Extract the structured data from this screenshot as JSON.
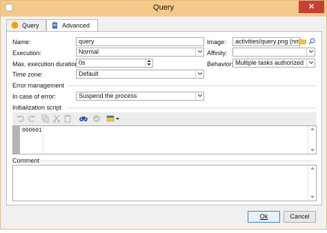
{
  "window": {
    "title": "Query",
    "close_glyph": "✕"
  },
  "tabs": [
    {
      "label": "Query",
      "icon": "query-circle-icon"
    },
    {
      "label": "Advanced",
      "icon": "clipboard-icon"
    }
  ],
  "form": {
    "name_label": "Name:",
    "name_value": "query",
    "image_label": "Image:",
    "image_value": "activities/query.png (nms",
    "execution_label": "Execution:",
    "execution_value": "Normal",
    "affinity_label": "Affinity:",
    "affinity_value": "",
    "max_exec_label": "Max. execution duration:",
    "max_exec_value": "0s",
    "behavior_label": "Behavior:",
    "behavior_value": "Multiple tasks authorized",
    "timezone_label": "Time zone:",
    "timezone_value": "Default"
  },
  "error_mgmt": {
    "section_label": "Error management",
    "in_case_label": "In case of error:",
    "in_case_value": "Suspend the process"
  },
  "script": {
    "section_label": "Initialization script",
    "line_number": "000001"
  },
  "comment": {
    "label": "Comment"
  },
  "buttons": {
    "ok": "Ok",
    "cancel": "Cancel"
  },
  "colors": {
    "titlebar": "#f5c98a",
    "close": "#c84031",
    "query_icon": "#f0a014",
    "clipboard": "#3a6fb0"
  }
}
